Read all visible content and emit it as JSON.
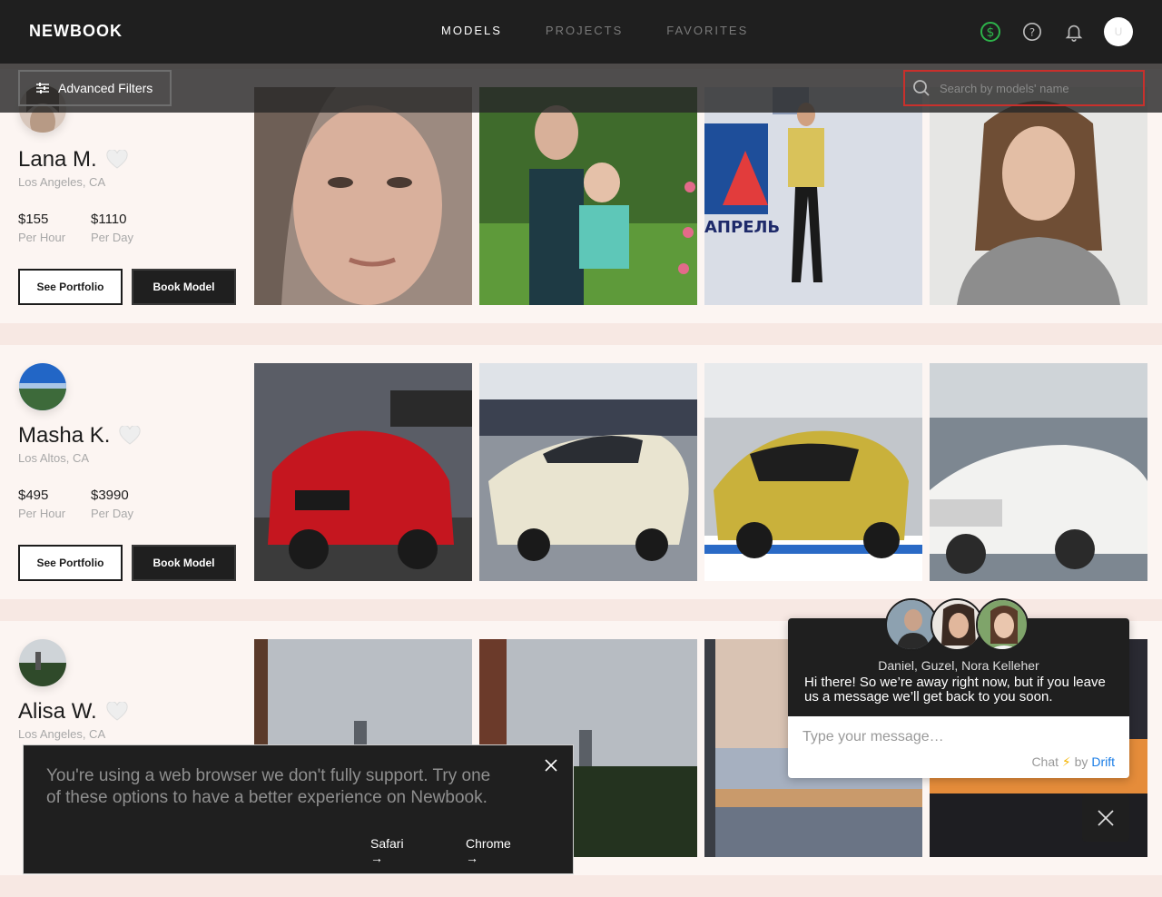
{
  "header": {
    "logo": "NEWBOOK",
    "nav": [
      {
        "label": "MODELS",
        "active": true
      },
      {
        "label": "PROJECTS",
        "active": false
      },
      {
        "label": "FAVORITES",
        "active": false
      }
    ],
    "avatar_initial": "U"
  },
  "filters": {
    "advanced_label": "Advanced Filters",
    "search_placeholder": "Search by models' name"
  },
  "models": [
    {
      "name": "Lana M.",
      "location": "Los Angeles, CA",
      "hour_price": "$155",
      "hour_label": "Per Hour",
      "day_price": "$1110",
      "day_label": "Per Day",
      "portfolio_label": "See Portfolio",
      "book_label": "Book Model"
    },
    {
      "name": "Masha K.",
      "location": "Los Altos, CA",
      "hour_price": "$495",
      "hour_label": "Per Hour",
      "day_price": "$3990",
      "day_label": "Per Day",
      "portfolio_label": "See Portfolio",
      "book_label": "Book Model"
    },
    {
      "name": "Alisa W.",
      "location": "Los Angeles, CA"
    }
  ],
  "notice": {
    "text": "You're using a web browser we don't fully support. Try one of these options to have a better experience on Newbook.",
    "safari": "Safari",
    "chrome": "Chrome"
  },
  "chat": {
    "names": "Daniel, Guzel, Nora Kelleher",
    "message": "Hi there! So we’re away right now, but if you leave us a message we’ll get back to you soon.",
    "input_placeholder": "Type your message…",
    "by_prefix": "Chat",
    "by_mid": "by",
    "by_brand": "Drift"
  },
  "colors": {
    "dark": "#1f1f1f",
    "accent_red": "#c9302c",
    "dollar_green": "#2db34a",
    "drift_blue": "#1a7de6"
  }
}
